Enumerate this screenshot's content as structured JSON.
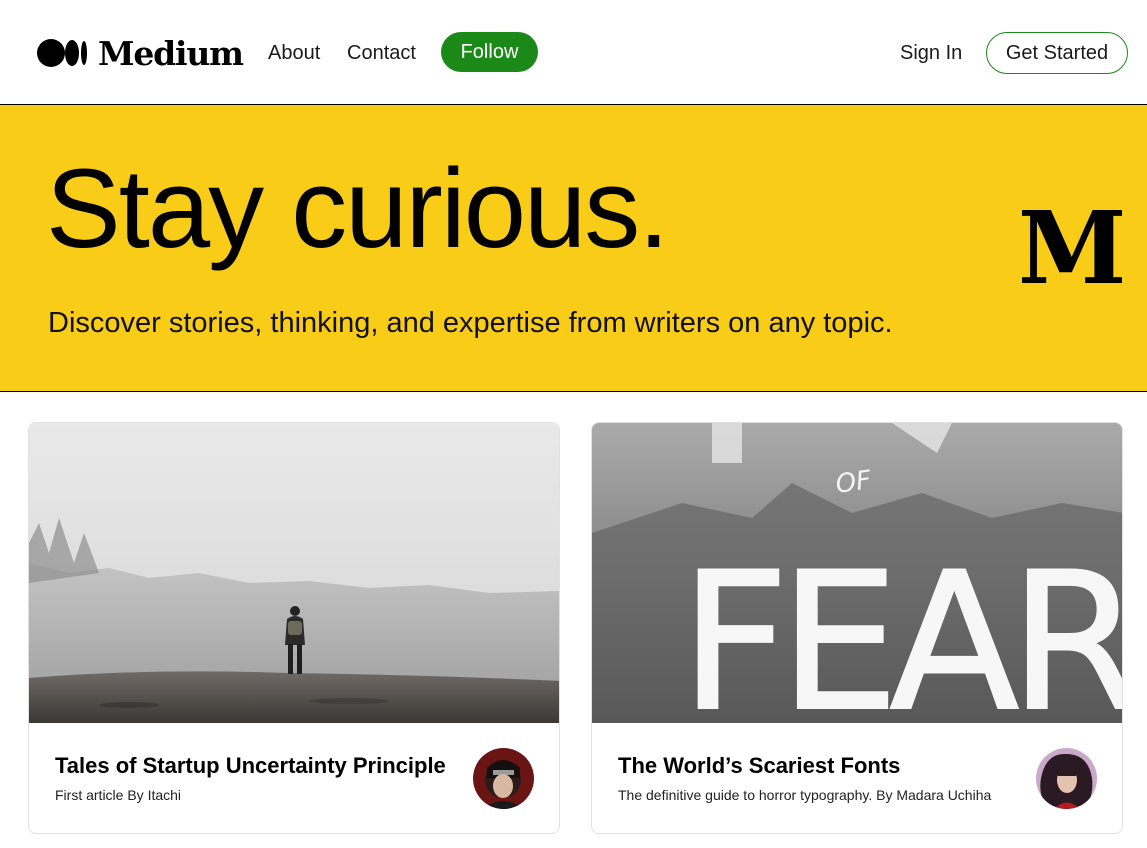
{
  "nav": {
    "brand": "Medium",
    "links": {
      "about": "About",
      "contact": "Contact"
    },
    "follow_label": "Follow",
    "signin_label": "Sign In",
    "get_started_label": "Get Started",
    "accent_color": "#1a8917"
  },
  "hero": {
    "title": "Stay curious.",
    "subtitle": "Discover stories, thinking, and expertise from writers on any topic.",
    "background_color": "#f9cc17",
    "emblem": "M"
  },
  "cards": [
    {
      "title": "Tales of Startup Uncertainty Principle",
      "description": "First article By Itachi",
      "image": "foggy-landscape-person",
      "avatar": "author-itachi-avatar"
    },
    {
      "title": "The World’s Scariest Fonts",
      "description": "The definitive guide to horror typography. By Madara Uchiha",
      "image": "fonts-of-fear-poster",
      "image_text_top": "OF",
      "image_text_main": "FEAR",
      "avatar": "author-madara-avatar"
    }
  ]
}
